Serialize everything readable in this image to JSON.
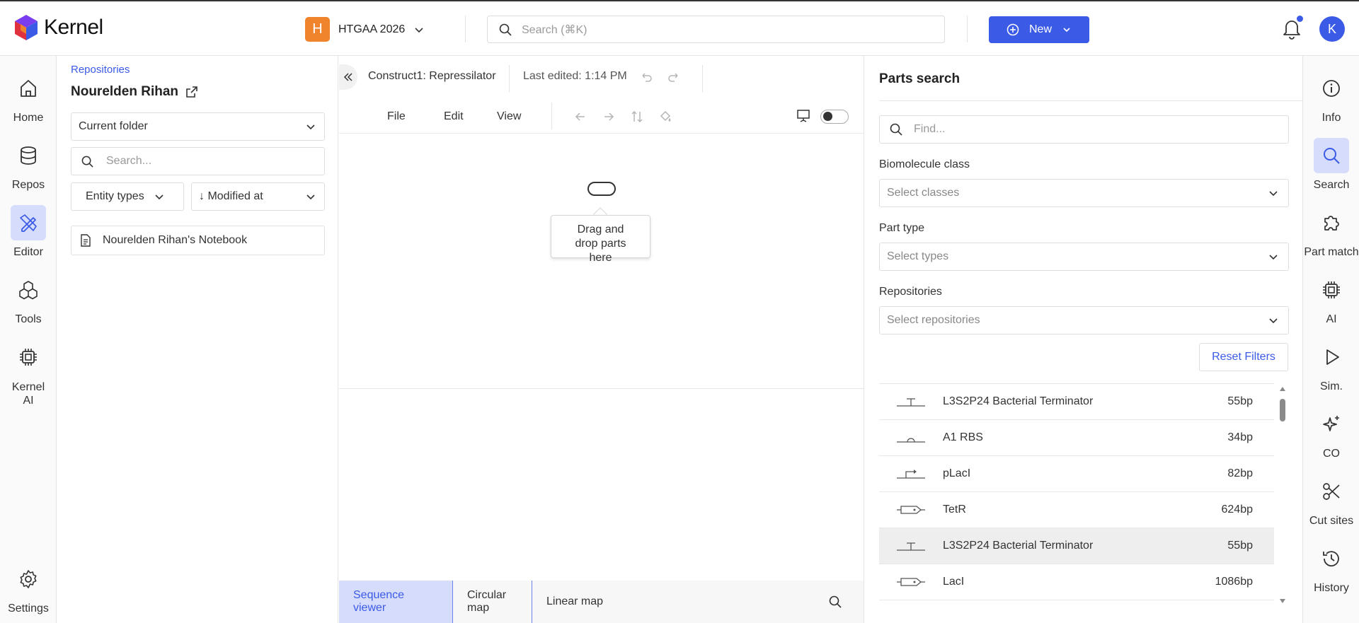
{
  "app": {
    "name": "Kernel"
  },
  "workspace": {
    "badge": "H",
    "name": "HTGAA 2026"
  },
  "search": {
    "placeholder": "Search (⌘K)"
  },
  "header": {
    "new_label": "New",
    "avatar_letter": "K"
  },
  "leftnav": {
    "items": [
      {
        "label": "Home",
        "icon": "home-icon"
      },
      {
        "label": "Repos",
        "icon": "database-icon"
      },
      {
        "label": "Editor",
        "icon": "editor-icon",
        "active": true
      },
      {
        "label": "Tools",
        "icon": "tools-icon"
      },
      {
        "label": "Kernel AI",
        "icon": "chip-icon"
      },
      {
        "label": "Settings",
        "icon": "gear-icon"
      }
    ]
  },
  "files": {
    "breadcrumb": "Repositories",
    "owner": "Nourelden Rihan",
    "folder_select": "Current folder",
    "search_placeholder": "Search...",
    "entity_types": "Entity types",
    "sort": "↓ Modified at",
    "items": [
      {
        "name": "Nourelden Rihan's Notebook"
      }
    ]
  },
  "editor": {
    "title": "Construct1: Repressilator",
    "last_edited": "Last edited: 1:14 PM",
    "menus": [
      "File",
      "Edit",
      "View"
    ],
    "drop_hint": "Drag and drop parts here",
    "tabs": [
      "Sequence viewer",
      "Circular map",
      "Linear map"
    ],
    "active_tab": "Sequence viewer"
  },
  "parts": {
    "title": "Parts search",
    "find_placeholder": "Find...",
    "biomolecule_label": "Biomolecule class",
    "biomolecule_placeholder": "Select classes",
    "parttype_label": "Part type",
    "parttype_placeholder": "Select types",
    "repos_label": "Repositories",
    "repos_placeholder": "Select repositories",
    "reset_label": "Reset Filters",
    "results": [
      {
        "name": "L3S2P24 Bacterial Terminator",
        "length": "55bp",
        "glyph": "terminator"
      },
      {
        "name": "A1 RBS",
        "length": "34bp",
        "glyph": "rbs"
      },
      {
        "name": "pLacI",
        "length": "82bp",
        "glyph": "promoter"
      },
      {
        "name": "TetR",
        "length": "624bp",
        "glyph": "cds"
      },
      {
        "name": "L3S2P24 Bacterial Terminator",
        "length": "55bp",
        "glyph": "terminator",
        "highlighted": true
      },
      {
        "name": "LacI",
        "length": "1086bp",
        "glyph": "cds"
      }
    ]
  },
  "rightnav": {
    "items": [
      {
        "label": "Info",
        "icon": "info-icon"
      },
      {
        "label": "Search",
        "icon": "search-icon",
        "active": true
      },
      {
        "label": "Part match",
        "icon": "puzzle-icon"
      },
      {
        "label": "AI",
        "icon": "chip-icon"
      },
      {
        "label": "Sim.",
        "icon": "play-icon"
      },
      {
        "label": "CO",
        "icon": "sparkle-icon"
      },
      {
        "label": "Cut sites",
        "icon": "scissors-icon"
      },
      {
        "label": "History",
        "icon": "history-icon"
      }
    ]
  },
  "colors": {
    "accent": "#3b5be6",
    "workspace_badge": "#f0842c",
    "active_bg": "#d6dcfb"
  }
}
